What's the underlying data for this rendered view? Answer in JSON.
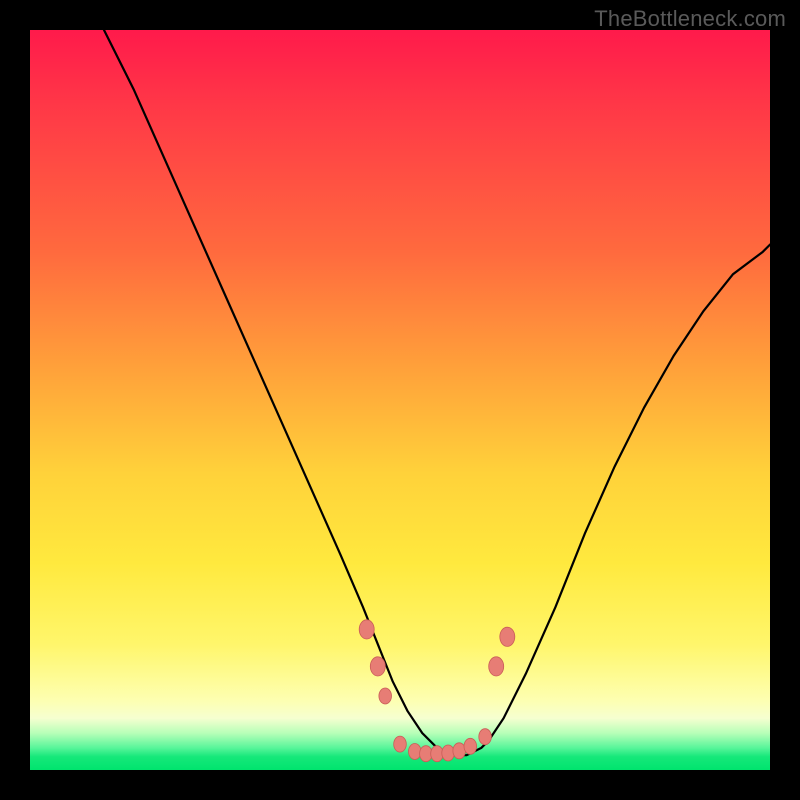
{
  "watermark": "TheBottleneck.com",
  "colors": {
    "curve": "#000000",
    "dot_fill": "#e77d75",
    "dot_stroke": "#c95d57"
  },
  "chart_data": {
    "type": "line",
    "title": "",
    "xlabel": "",
    "ylabel": "",
    "xlim": [
      0,
      100
    ],
    "ylim": [
      0,
      100
    ],
    "grid": false,
    "legend": false,
    "notes": "V-shaped bottleneck curve over a vertical red→yellow→green gradient. y≈100 is worst (red), y≈0 near bottom is best (green). Minimum (valley floor) sits slightly right of center. Salmon dots mark sampled performance points near the valley.",
    "series": [
      {
        "name": "bottleneck-curve",
        "x": [
          10,
          14,
          18,
          22,
          26,
          30,
          34,
          38,
          42,
          45,
          47,
          49,
          51,
          53,
          55,
          57,
          59,
          61,
          62,
          64,
          67,
          71,
          75,
          79,
          83,
          87,
          91,
          95,
          99,
          100
        ],
        "y": [
          100,
          92,
          83,
          74,
          65,
          56,
          47,
          38,
          29,
          22,
          17,
          12,
          8,
          5,
          3,
          2,
          2,
          3,
          4,
          7,
          13,
          22,
          32,
          41,
          49,
          56,
          62,
          67,
          70,
          71
        ]
      }
    ],
    "points": [
      {
        "name": "dot",
        "x": 45.5,
        "y": 19,
        "r": 6
      },
      {
        "name": "dot",
        "x": 47.0,
        "y": 14,
        "r": 6
      },
      {
        "name": "dot",
        "x": 48.0,
        "y": 10,
        "r": 5
      },
      {
        "name": "dot",
        "x": 50.0,
        "y": 3.5,
        "r": 5
      },
      {
        "name": "dot",
        "x": 52.0,
        "y": 2.5,
        "r": 5
      },
      {
        "name": "dot",
        "x": 53.5,
        "y": 2.2,
        "r": 5
      },
      {
        "name": "dot",
        "x": 55.0,
        "y": 2.2,
        "r": 5
      },
      {
        "name": "dot",
        "x": 56.5,
        "y": 2.3,
        "r": 5
      },
      {
        "name": "dot",
        "x": 58.0,
        "y": 2.6,
        "r": 5
      },
      {
        "name": "dot",
        "x": 59.5,
        "y": 3.2,
        "r": 5
      },
      {
        "name": "dot",
        "x": 61.5,
        "y": 4.5,
        "r": 5
      },
      {
        "name": "dot",
        "x": 63.0,
        "y": 14,
        "r": 6
      },
      {
        "name": "dot",
        "x": 64.5,
        "y": 18,
        "r": 6
      }
    ]
  }
}
